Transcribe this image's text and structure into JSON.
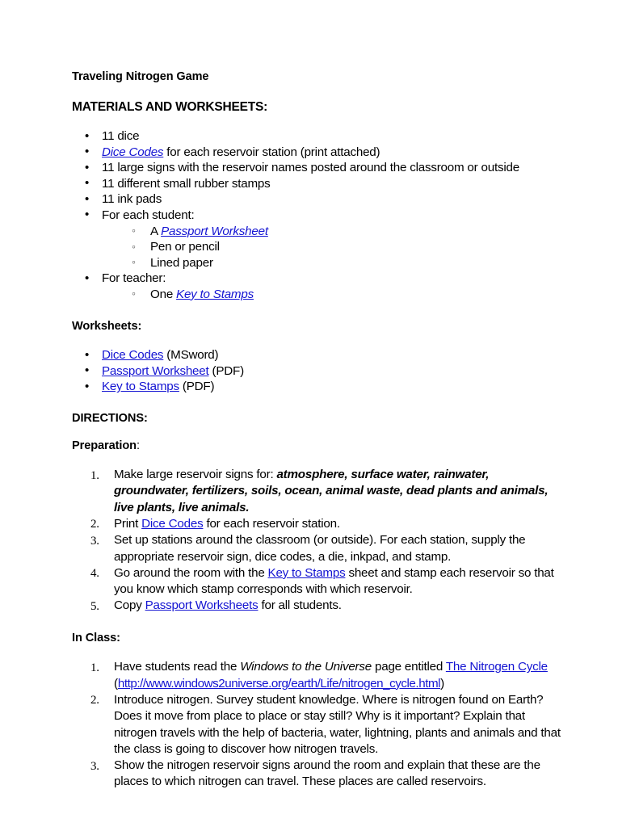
{
  "document": {
    "title": "Traveling Nitrogen Game",
    "materials_heading": "MATERIALS AND WORKSHEETS:",
    "materials": {
      "item_dice": "11 dice",
      "item_dice_codes_link": "Dice Codes",
      "item_dice_codes_rest": " for each reservoir station (print attached)",
      "item_signs": "11 large signs with the reservoir names posted around the classroom or outside",
      "item_stamps": "11 different small rubber stamps",
      "item_inkpads": "11 ink pads",
      "item_for_each_student": "For each student:",
      "sub_passport_prefix": "A ",
      "sub_passport_link": "Passport Worksheet",
      "sub_pen": "Pen or pencil",
      "sub_lined_paper": "Lined paper",
      "item_for_teacher": "For teacher:",
      "sub_key_prefix": "One ",
      "sub_key_link": "Key to Stamps"
    },
    "worksheets_heading": "Worksheets:",
    "worksheets": [
      {
        "link": "Dice Codes",
        "format": " (MSword)"
      },
      {
        "link": "Passport Worksheet",
        "format": " (PDF)"
      },
      {
        "link": "Key to Stamps",
        "format": " (PDF)"
      }
    ],
    "directions_heading": "DIRECTIONS:",
    "preparation_heading": "Preparation",
    "preparation_heading_colon": ":",
    "preparation_steps": {
      "step1_prefix": "Make large reservoir signs for: ",
      "step1_reservoirs": "atmosphere, surface water, rainwater, groundwater, fertilizers, soils, ocean, animal waste, dead plants and animals, live plants, live animals.",
      "step2_prefix": "Print ",
      "step2_link": "Dice Codes",
      "step2_suffix": " for each reservoir station.",
      "step3": "Set up stations around the classroom (or outside). For each station, supply the appropriate reservoir sign, dice codes, a die, inkpad, and stamp.",
      "step4_prefix": "Go around the room with the ",
      "step4_link": "Key to Stamps",
      "step4_suffix": " sheet and stamp each reservoir so that you know which stamp corresponds with which reservoir.",
      "step5_prefix": "Copy ",
      "step5_link": "Passport Worksheets",
      "step5_suffix": " for all students."
    },
    "in_class_heading": "In Class:",
    "in_class_steps": {
      "step1_prefix": "Have students read the ",
      "step1_publication": "Windows to the Universe",
      "step1_middle": " page entitled ",
      "step1_link": "The Nitrogen Cycle",
      "step1_open_paren": " (",
      "step1_url": "http://www.windows2universe.org/earth/Life/nitrogen_cycle.html",
      "step1_close_paren": ")",
      "step2": "Introduce nitrogen. Survey student knowledge. Where is nitrogen found on Earth? Does it move from place to place or stay still? Why is it important? Explain that nitrogen travels with the help of bacteria, water, lightning, plants and animals and that the class is going to discover how nitrogen travels.",
      "step3": "Show the nitrogen reservoir signs around the room and explain that these are the places to which nitrogen can travel. These places are called reservoirs."
    },
    "colors": {
      "link": "#1414d2",
      "text": "#000000",
      "background": "#ffffff"
    }
  }
}
